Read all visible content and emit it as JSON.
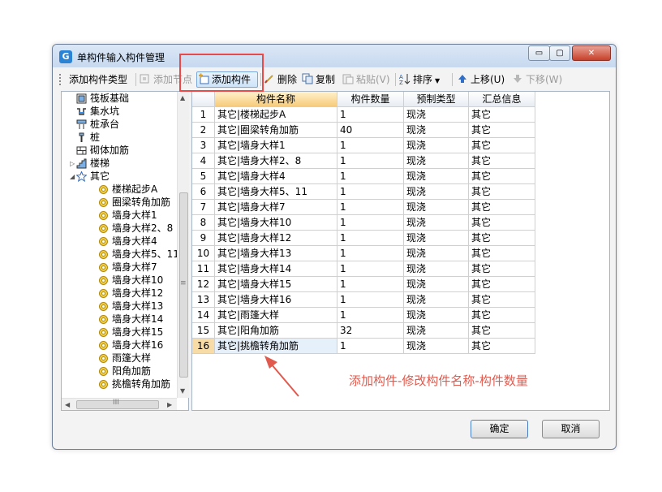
{
  "window": {
    "title": "单构件输入构件管理",
    "controls": {
      "minimize": "▭",
      "maximize": "▢",
      "close": "✕"
    }
  },
  "toolbar": {
    "add_type_label": "添加构件类型",
    "add_node_label": "添加节点",
    "add_component_label": "添加构件",
    "delete_label": "删除",
    "copy_label": "复制",
    "paste_label": "粘贴(V)",
    "sort_label": "排序",
    "move_up_label": "上移(U)",
    "move_down_label": "下移(W)"
  },
  "tree": {
    "items": [
      {
        "label": "筏板基础",
        "icon": "raft-icon"
      },
      {
        "label": "集水坑",
        "icon": "pit-icon"
      },
      {
        "label": "桩承台",
        "icon": "pile-cap-icon"
      },
      {
        "label": "桩",
        "icon": "pile-icon"
      },
      {
        "label": "砌体加筋",
        "icon": "masonry-icon"
      },
      {
        "label": "楼梯",
        "icon": "stairs-icon"
      },
      {
        "label": "其它",
        "icon": "star-icon"
      }
    ],
    "children": [
      "楼梯起步A",
      "圈梁转角加筋",
      "墙身大样1",
      "墙身大样2、8",
      "墙身大样4",
      "墙身大样5、11",
      "墙身大样7",
      "墙身大样10",
      "墙身大样12",
      "墙身大样13",
      "墙身大样14",
      "墙身大样15",
      "墙身大样16",
      "雨篷大样",
      "阳角加筋",
      "挑檐转角加筋"
    ],
    "scroll_thumb_glyph": "≡",
    "hscroll_glyph": "III"
  },
  "grid": {
    "headers": [
      "构件名称",
      "构件数量",
      "预制类型",
      "汇总信息"
    ],
    "rows": [
      {
        "num": "1",
        "name": "其它|楼梯起步A",
        "qty": "1",
        "type": "现浇",
        "summary": "其它"
      },
      {
        "num": "2",
        "name": "其它|圈梁转角加筋",
        "qty": "40",
        "type": "现浇",
        "summary": "其它"
      },
      {
        "num": "3",
        "name": "其它|墙身大样1",
        "qty": "1",
        "type": "现浇",
        "summary": "其它"
      },
      {
        "num": "4",
        "name": "其它|墙身大样2、8",
        "qty": "1",
        "type": "现浇",
        "summary": "其它"
      },
      {
        "num": "5",
        "name": "其它|墙身大样4",
        "qty": "1",
        "type": "现浇",
        "summary": "其它"
      },
      {
        "num": "6",
        "name": "其它|墙身大样5、11",
        "qty": "1",
        "type": "现浇",
        "summary": "其它"
      },
      {
        "num": "7",
        "name": "其它|墙身大样7",
        "qty": "1",
        "type": "现浇",
        "summary": "其它"
      },
      {
        "num": "8",
        "name": "其它|墙身大样10",
        "qty": "1",
        "type": "现浇",
        "summary": "其它"
      },
      {
        "num": "9",
        "name": "其它|墙身大样12",
        "qty": "1",
        "type": "现浇",
        "summary": "其它"
      },
      {
        "num": "10",
        "name": "其它|墙身大样13",
        "qty": "1",
        "type": "现浇",
        "summary": "其它"
      },
      {
        "num": "11",
        "name": "其它|墙身大样14",
        "qty": "1",
        "type": "现浇",
        "summary": "其它"
      },
      {
        "num": "12",
        "name": "其它|墙身大样15",
        "qty": "1",
        "type": "现浇",
        "summary": "其它"
      },
      {
        "num": "13",
        "name": "其它|墙身大样16",
        "qty": "1",
        "type": "现浇",
        "summary": "其它"
      },
      {
        "num": "14",
        "name": "其它|雨篷大样",
        "qty": "1",
        "type": "现浇",
        "summary": "其它"
      },
      {
        "num": "15",
        "name": "其它|阳角加筋",
        "qty": "32",
        "type": "现浇",
        "summary": "其它"
      },
      {
        "num": "16",
        "name": "其它|挑檐转角加筋",
        "qty": "1",
        "type": "现浇",
        "summary": "其它"
      }
    ],
    "selected_row": "16"
  },
  "buttons": {
    "ok": "确定",
    "cancel": "取消"
  },
  "annotation": {
    "text": "添加构件-修改构件名称-构件数量"
  },
  "colors": {
    "highlight": "#e84a4a",
    "annotation": "#e05a4e",
    "selected_row": "#f8dca8"
  }
}
